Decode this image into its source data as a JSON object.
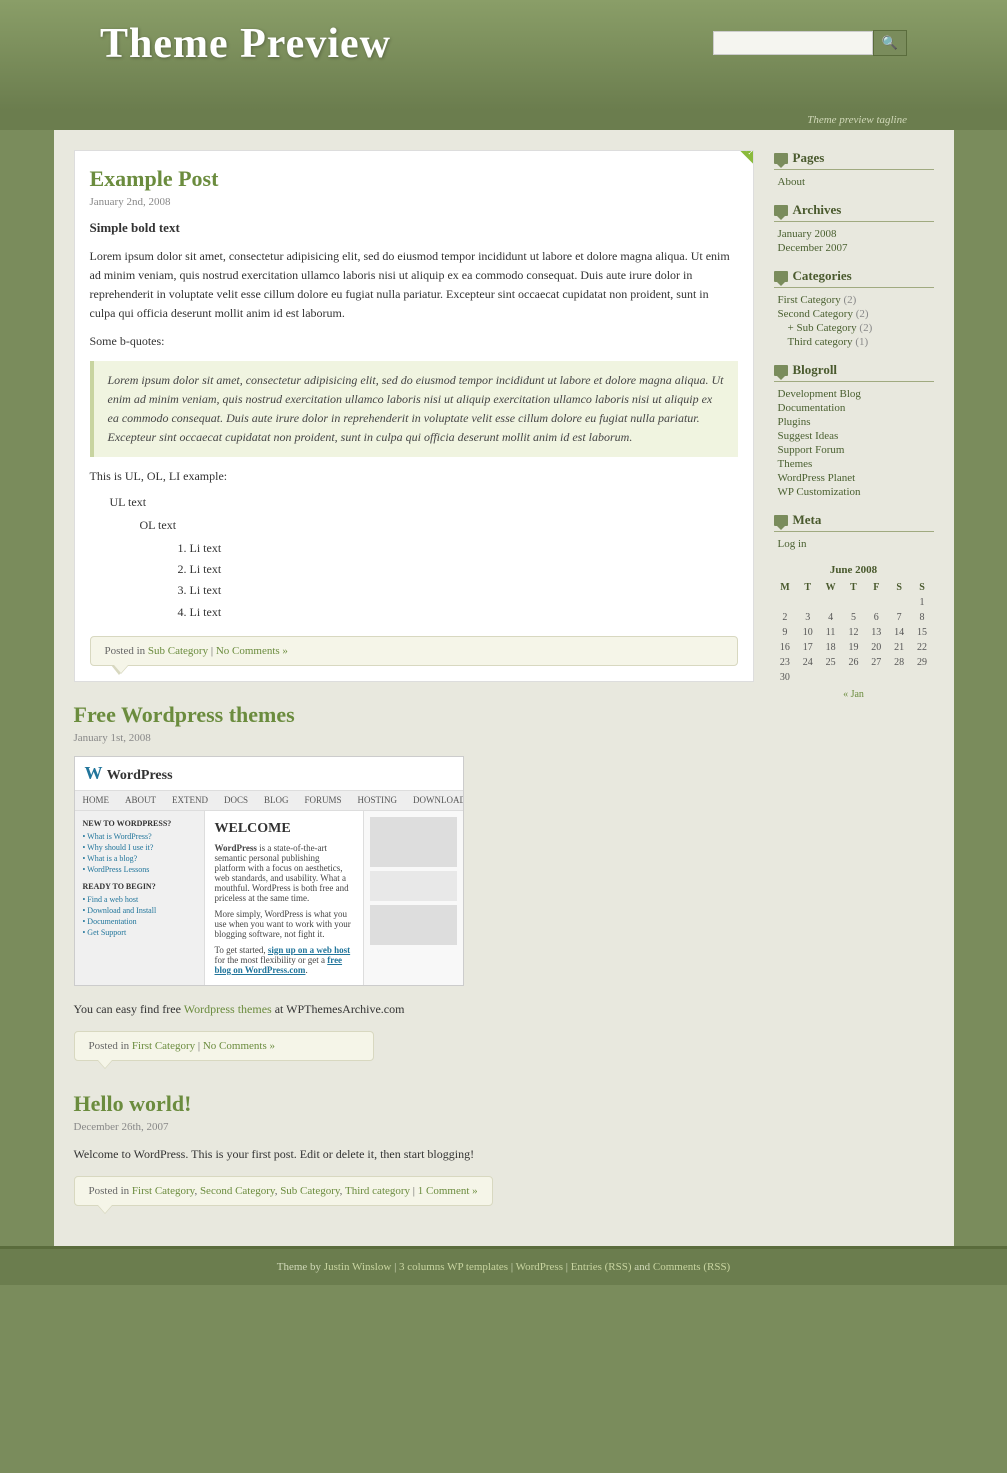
{
  "site": {
    "title": "Theme Preview",
    "tagline": "Theme preview tagline"
  },
  "search": {
    "placeholder": "",
    "button_label": "🔍"
  },
  "posts": [
    {
      "id": "example-post",
      "title": "Example Post",
      "date": "January 2nd, 2008",
      "is_new": true,
      "content_heading": "Simple bold text",
      "paragraph1": "Lorem ipsum dolor sit amet, consectetur adipisicing elit, sed do eiusmod tempor incididunt ut labore et dolore magna aliqua. Ut enim ad minim veniam, quis nostrud exercitation ullamco laboris nisi ut aliquip ex ea commodo consequat. Duis aute irure dolor in reprehenderit in voluptate velit esse cillum dolore eu fugiat nulla pariatur. Excepteur sint occaecat cupidatat non proident, sunt in culpa qui officia deserunt mollit anim id est laborum.",
      "bquote_label": "Some b-quotes:",
      "blockquote": "Lorem ipsum dolor sit amet, consectetur adipisicing elit, sed do eiusmod tempor incididunt ut labore et dolore magna aliqua. Ut enim ad minim veniam, quis nostrud exercitation ullamco laboris nisi ut aliquip exercitation ullamco laboris nisi ut aliquip ex ea commodo consequat. Duis aute irure dolor in reprehenderit in voluptate velit esse cillum dolore eu fugiat nulla pariatur. Excepteur sint occaecat cupidatat non proident, sunt in culpa qui officia deserunt mollit anim id est laborum.",
      "ul_label": "This is UL, OL, LI example:",
      "ul_item": "UL text",
      "ol_item": "OL text",
      "li_items": [
        "Li text",
        "Li text",
        "Li text",
        "Li text"
      ],
      "footer_prefix": "Posted in",
      "footer_category": "Sub Category",
      "footer_separator": "|",
      "footer_comments": "No Comments »"
    },
    {
      "id": "free-wp-themes",
      "title": "Free Wordpress themes",
      "date": "January 1st, 2008",
      "paragraph": "You can easy find free Wordpress themes at WPThemesArchive.com",
      "paragraph_link": "Wordpress themes",
      "paragraph_rest": " at WPThemesArchive.com",
      "footer_prefix": "Posted in",
      "footer_category": "First Category",
      "footer_separator": "|",
      "footer_comments": "No Comments »"
    },
    {
      "id": "hello-world",
      "title": "Hello world!",
      "date": "December 26th, 2007",
      "paragraph": "Welcome to WordPress. This is your first post. Edit or delete it, then start blogging!",
      "footer_prefix": "Posted in",
      "footer_categories": [
        "First Category",
        "Second Category",
        "Sub Category",
        "Third category"
      ],
      "footer_separator": "|",
      "footer_comments": "1 Comment »"
    }
  ],
  "sidebar": {
    "pages_heading": "Pages",
    "pages": [
      {
        "label": "About",
        "href": "#"
      }
    ],
    "archives_heading": "Archives",
    "archives": [
      {
        "label": "January 2008",
        "href": "#"
      },
      {
        "label": "December 2007",
        "href": "#"
      }
    ],
    "categories_heading": "Categories",
    "categories": [
      {
        "label": "First Category",
        "count": "(2)",
        "href": "#",
        "indent": false
      },
      {
        "label": "Second Category",
        "count": "(2)",
        "href": "#",
        "indent": false
      },
      {
        "label": "+ Sub Category",
        "count": "(2)",
        "href": "#",
        "indent": true
      },
      {
        "label": "Third category",
        "count": "(1)",
        "href": "#",
        "indent": true
      }
    ],
    "blogroll_heading": "Blogroll",
    "blogroll": [
      {
        "label": "Development Blog",
        "href": "#"
      },
      {
        "label": "Documentation",
        "href": "#"
      },
      {
        "label": "Plugins",
        "href": "#"
      },
      {
        "label": "Suggest Ideas",
        "href": "#"
      },
      {
        "label": "Support Forum",
        "href": "#"
      },
      {
        "label": "Themes",
        "href": "#"
      },
      {
        "label": "WordPress Planet",
        "href": "#"
      },
      {
        "label": "WP Customization",
        "href": "#"
      }
    ],
    "meta_heading": "Meta",
    "meta": [
      {
        "label": "Log in",
        "href": "#"
      }
    ],
    "calendar": {
      "title": "June 2008",
      "weekdays": [
        "M",
        "T",
        "W",
        "T",
        "F",
        "S",
        "S"
      ],
      "rows": [
        [
          "",
          "",
          "",
          "",
          "",
          "",
          "1"
        ],
        [
          "2",
          "3",
          "4",
          "5",
          "6",
          "7",
          "8"
        ],
        [
          "9",
          "10",
          "11",
          "12",
          "13",
          "14",
          "15"
        ],
        [
          "16",
          "17",
          "18",
          "19",
          "20",
          "21",
          "22"
        ],
        [
          "23",
          "24",
          "25",
          "26",
          "27",
          "28",
          "29"
        ],
        [
          "30",
          "",
          "",
          "",
          "",
          "",
          ""
        ]
      ],
      "prev": "« Jan"
    }
  },
  "footer": {
    "theme_by": "Theme by",
    "author": "Justin Winslow",
    "separator1": "|",
    "link2": "3 columns WP templates",
    "separator2": "|",
    "link3": "WordPress",
    "separator3": "|",
    "link4": "Entries (RSS)",
    "and": "and",
    "link5": "Comments (RSS)"
  }
}
